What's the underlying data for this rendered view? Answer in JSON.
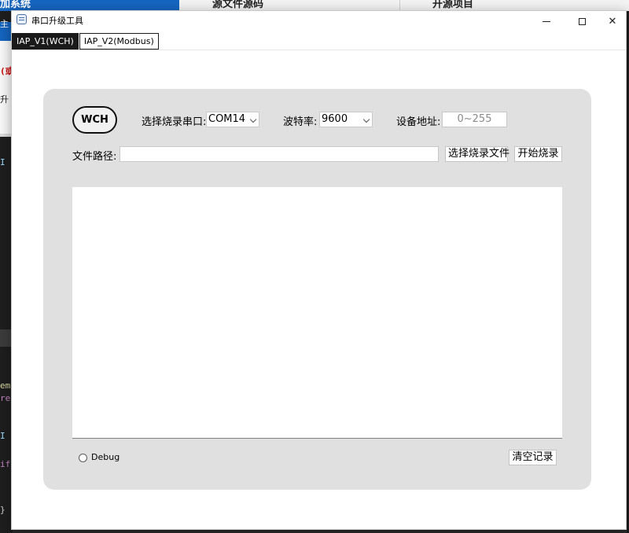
{
  "background": {
    "top_texts": [
      "加系统",
      "源文件源码",
      "开源项目"
    ],
    "left_glyphs": [
      "主",
      "(或",
      "升",
      "I",
      "ema",
      "re",
      "I",
      "if",
      "}"
    ]
  },
  "window": {
    "title": "串口升级工具",
    "icons": {
      "app": "app-icon",
      "minimize": "minimize-icon",
      "maximize": "maximize-icon",
      "close": "close-icon"
    },
    "close_glyph": "✕"
  },
  "tabs": [
    {
      "label": "IAP_V1(WCH)",
      "active": true
    },
    {
      "label": "IAP_V2(Modbus)",
      "active": false
    }
  ],
  "panel": {
    "badge": "WCH",
    "port_label": "选择烧录串口:",
    "port_value": "COM14",
    "baud_label": "波特率:",
    "baud_value": "9600",
    "addr_label": "设备地址:",
    "addr_placeholder": "0~255",
    "path_label": "文件路径:",
    "path_value": "",
    "choose_file_button": "选择烧录文件",
    "start_button": "开始烧录",
    "log_text": "",
    "debug_label": "Debug",
    "debug_checked": false,
    "clear_button": "清空记录"
  },
  "colors": {
    "panel_bg": "#e0e0e0",
    "tab_active_bg": "#1a1a1a",
    "bg_blue": "#1565c0"
  }
}
